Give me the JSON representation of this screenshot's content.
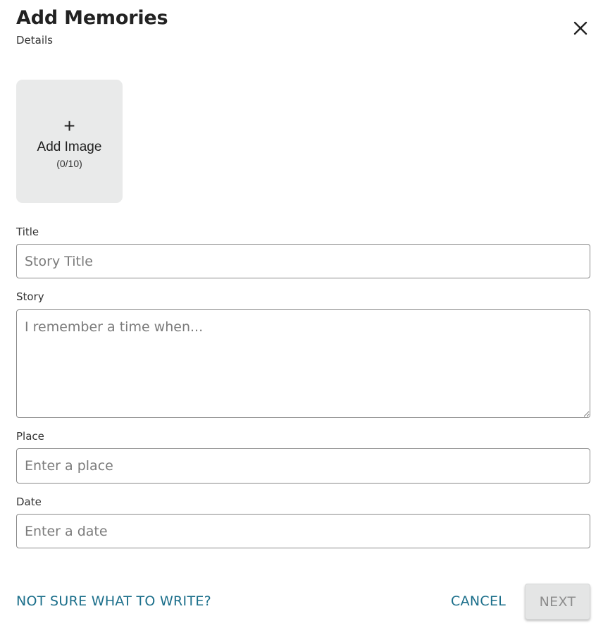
{
  "dialog": {
    "title": "Add Memories",
    "subtitle": "Details",
    "close_icon": "close-icon"
  },
  "add_image": {
    "icon": "plus-icon",
    "plus_glyph": "+",
    "label": "Add Image",
    "count": "(0/10)"
  },
  "fields": {
    "title": {
      "label": "Title",
      "value": "",
      "placeholder": "Story Title"
    },
    "story": {
      "label": "Story",
      "value": "",
      "placeholder": "I remember a time when..."
    },
    "place": {
      "label": "Place",
      "value": "",
      "placeholder": "Enter a place"
    },
    "date": {
      "label": "Date",
      "value": "",
      "placeholder": "Enter a date"
    }
  },
  "footer": {
    "help_link": "NOT SURE WHAT TO WRITE?",
    "cancel_label": "CANCEL",
    "next_label": "NEXT",
    "next_disabled": true
  },
  "colors": {
    "accent": "#1a6e8a",
    "tile_bg": "#e9eaea",
    "disabled_text": "#8d8d8d"
  }
}
